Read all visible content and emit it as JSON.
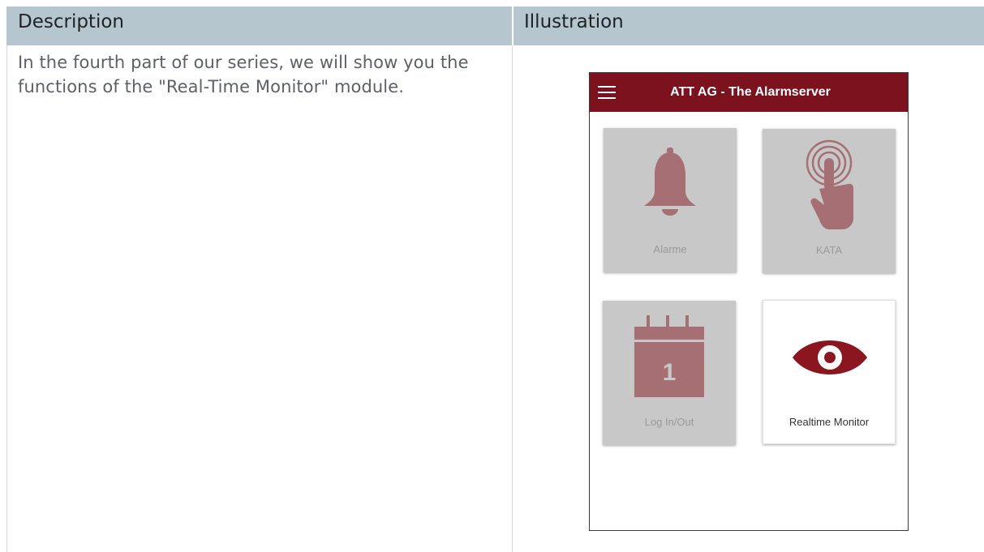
{
  "table": {
    "header": {
      "description": "Description",
      "illustration": "Illustration"
    },
    "description_text": "In the fourth part of our series, we will show you the functions of the \"Real-Time Monitor\" module."
  },
  "phone": {
    "app_title": "ATT AG - The Alarmserver",
    "tiles": [
      {
        "label": "Alarme",
        "icon": "bell-icon",
        "state": "disabled"
      },
      {
        "label": "KATA",
        "icon": "touch-icon",
        "state": "disabled"
      },
      {
        "label": "Log In/Out",
        "icon": "calendar-icon",
        "state": "disabled",
        "icon_text": "1"
      },
      {
        "label": "Realtime Monitor",
        "icon": "eye-icon",
        "state": "enabled"
      }
    ]
  },
  "colors": {
    "header_bg": "#b5c6cf",
    "app_bar": "#7b121d",
    "icon_disabled": "#a56f73",
    "icon_enabled": "#8c1620",
    "tile_disabled": "#c8c8c8"
  }
}
